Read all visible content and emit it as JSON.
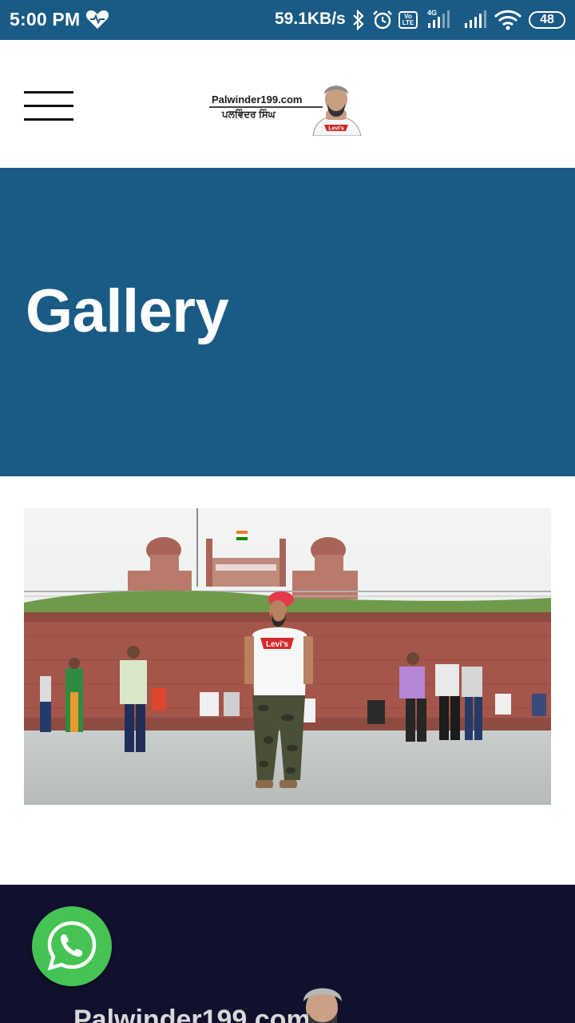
{
  "status_bar": {
    "time": "5:00 PM",
    "speed": "59.1KB/s",
    "volte": "Vo LTE",
    "network": "4G",
    "battery": "48",
    "icons": [
      "heart-icon",
      "bluetooth-icon",
      "alarm-icon",
      "volte-icon",
      "signal-icon",
      "wifi-icon",
      "battery-icon"
    ]
  },
  "header": {
    "menu_icon": "hamburger-menu-icon",
    "logo": {
      "title": "Palwinder199.com",
      "subtitle": "ਪਲਵਿੰਦਰ ਸਿੰਘ",
      "shirt_text": "Levi's"
    }
  },
  "hero": {
    "title": "Gallery"
  },
  "gallery": {
    "photo_shirt_text": "Levi's"
  },
  "footer": {
    "logo_text": "Palwinder199.com"
  },
  "whatsapp": {
    "icon": "whatsapp-icon",
    "color": "#45c354"
  },
  "colors": {
    "primary": "#1a5b85",
    "footer": "#11112e"
  }
}
